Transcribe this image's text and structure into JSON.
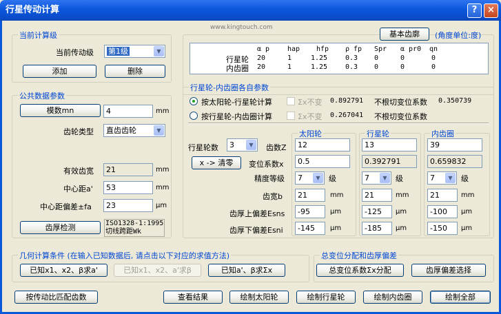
{
  "window": {
    "title": "行星传动计算",
    "help": "?",
    "close": "×"
  },
  "watermark": "www.kingtouch.com",
  "current_stage": {
    "group_label": "当前计算级",
    "field_label": "当前传动级",
    "value": "第1级",
    "add": "添加",
    "remove": "删除"
  },
  "common": {
    "group_label": "公共数据参数",
    "module_btn": "模数mn",
    "module_value": "4",
    "module_unit": "mm",
    "gear_type_label": "齿轮类型",
    "gear_type_value": "直齿齿轮",
    "effective_depth_label": "有效齿宽",
    "effective_depth_value": "21",
    "effective_depth_unit": "mm",
    "center_dist_label": "中心距a'",
    "center_dist_value": "53",
    "center_dist_unit": "mm",
    "center_dev_label": "中心距偏差±fa",
    "center_dev_value": "23",
    "center_dev_unit": "μm",
    "tooth_check_btn": "齿厚检测",
    "std_line1": "ISO1328-1:1995",
    "std_line2": "切线跨距Wk"
  },
  "basic_profile": {
    "button": "基本齿廓",
    "unit_note": "(角度单位:度)",
    "headers": [
      "α p",
      "hap",
      "hfp",
      "ρ fp",
      "Spr",
      "α pr0",
      "qn"
    ],
    "rows": [
      {
        "name": "行星轮",
        "values": [
          "20",
          "1",
          "1.25",
          "0.3",
          "0",
          "0",
          "0"
        ]
      },
      {
        "name": "内齿圈",
        "values": [
          "20",
          "1",
          "1.25",
          "0.3",
          "0",
          "0",
          "0"
        ]
      }
    ]
  },
  "params": {
    "group_label": "行星轮-内齿圈各自参数",
    "radio1": "按太阳轮-行星轮计算",
    "radio2": "按行星轮-内齿圈计算",
    "chk_label": "Σx不变",
    "r1_value": "0.892791",
    "r2_value": "0.267041",
    "r1_note": "不根切变位系数",
    "r1_note_value": "0.350739",
    "r2_note": "不根切变位系数",
    "planet_count_label": "行星轮数",
    "planet_count_value": "3",
    "clear_btn": "x -> 清零",
    "col_sun": "太阳轮",
    "col_planet": "行星轮",
    "col_ring": "内齿圈",
    "teeth_label": "齿数Z",
    "shift_label": "变位系数x",
    "grade_label": "精度等级",
    "width_label": "齿宽b",
    "esns_label": "齿厚上偏差Esns",
    "esni_label": "齿厚下偏差Esni",
    "grade_unit": "级",
    "mm": "mm",
    "um": "μm",
    "sun": {
      "teeth": "12",
      "shift": "0.5",
      "grade": "7",
      "width": "21",
      "esns": "-95",
      "esni": "-145"
    },
    "planet": {
      "teeth": "13",
      "shift": "0.392791",
      "grade": "7",
      "width": "21",
      "esns": "-125",
      "esni": "-185"
    },
    "ring": {
      "teeth": "39",
      "shift": "0.659832",
      "grade": "7",
      "width": "21",
      "esns": "-100",
      "esni": "-150"
    }
  },
  "geometry": {
    "group_label": "几何计算条件 (在输入已知数据后, 请点击以下对应的求值方法)",
    "b1": "已知x1、x2、β求a'",
    "b2": "已知x1、x2、a'求β",
    "b3": "已知a'、β求Σx"
  },
  "shift_dist": {
    "group_label": "总变位分配和齿厚偏差",
    "b1": "总变位系数Σx分配",
    "b2": "齿厚偏差选择"
  },
  "bottom": {
    "b0": "按传动比匹配齿数",
    "b1": "查看结果",
    "b2": "绘制太阳轮",
    "b3": "绘制行星轮",
    "b4": "绘制内齿圈",
    "b5": "绘制全部"
  }
}
